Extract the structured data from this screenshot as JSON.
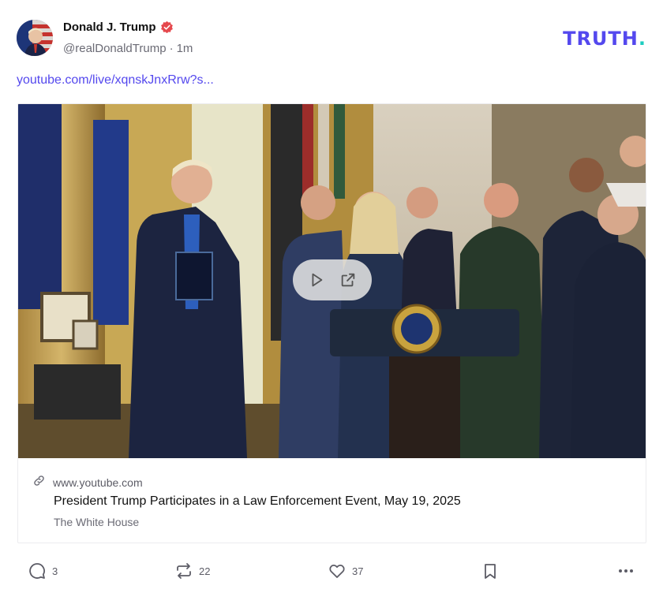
{
  "post": {
    "author": {
      "display_name": "Donald J. Trump",
      "handle": "@realDonaldTrump",
      "separator": "·",
      "time": "1m",
      "verified_color": "#e5484d"
    },
    "brand": {
      "text": "TRUTH",
      "dot": ".",
      "color": "#5448ee",
      "dot_color": "#1dcdc0"
    },
    "link_text": "youtube.com/live/xqnskJnxRrw?s...",
    "preview": {
      "domain": "www.youtube.com",
      "title": "President Trump Participates in a Law Enforcement Event, May 19, 2025",
      "source": "The White House",
      "play_icon": "play-icon",
      "open_icon": "external-link-icon"
    },
    "actions": {
      "replies": {
        "icon": "reply-icon",
        "count": "3"
      },
      "retruths": {
        "icon": "repost-icon",
        "count": "22"
      },
      "likes": {
        "icon": "heart-icon",
        "count": "37"
      },
      "bookmark": {
        "icon": "bookmark-icon"
      },
      "more": {
        "icon": "more-icon"
      }
    }
  }
}
